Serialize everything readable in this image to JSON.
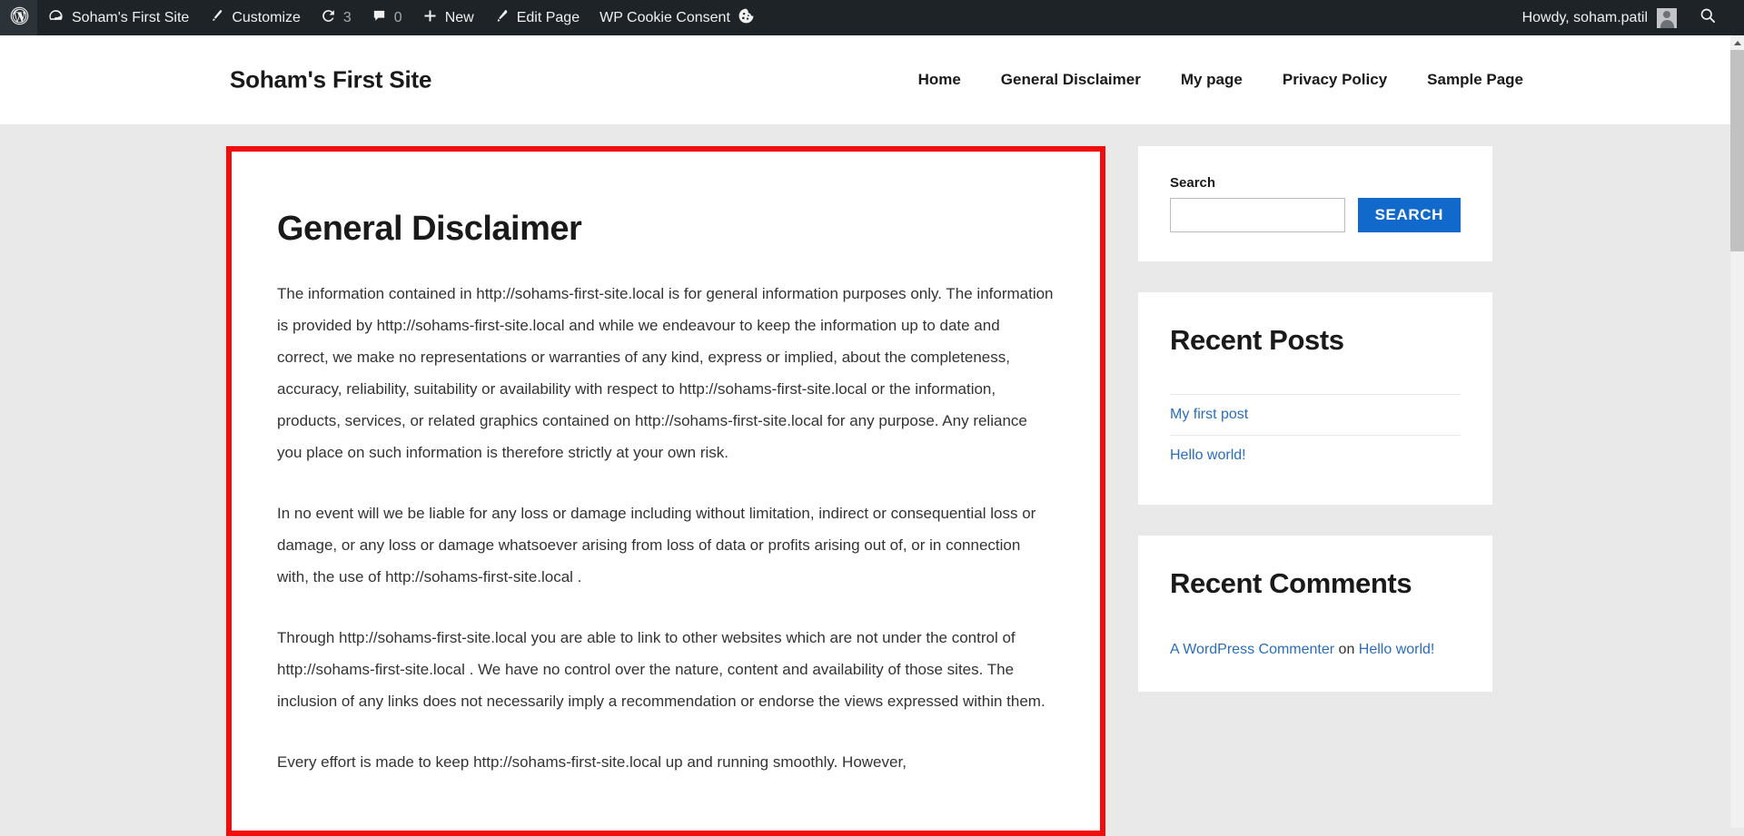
{
  "adminbar": {
    "wp_logo": "wordpress-logo",
    "site_name": "Soham's First Site",
    "customize": "Customize",
    "updates_count": "3",
    "comments_count": "0",
    "new": "New",
    "edit_page": "Edit Page",
    "cookie_consent": "WP Cookie Consent",
    "howdy": "Howdy, soham.patil"
  },
  "header": {
    "site_title": "Soham's First Site",
    "nav": [
      {
        "label": "Home"
      },
      {
        "label": "General Disclaimer"
      },
      {
        "label": "My page"
      },
      {
        "label": "Privacy Policy"
      },
      {
        "label": "Sample Page"
      }
    ]
  },
  "main": {
    "title": "General Disclaimer",
    "paragraphs": [
      "The information contained in http://sohams-first-site.local is for general information purposes only. The information is provided by http://sohams-first-site.local and while we endeavour to keep the information up to date and correct, we make no representations or warranties of any kind, express or implied, about the completeness, accuracy, reliability, suitability or availability with respect to http://sohams-first-site.local or the information, products, services, or related graphics contained on http://sohams-first-site.local for any purpose. Any reliance you place on such information is therefore strictly at your own risk.",
      "In no event will we be liable for any loss or damage including without limitation, indirect or consequential loss or damage, or any loss or damage whatsoever arising from loss of data or profits arising out of, or in connection with, the use of http://sohams-first-site.local .",
      "Through http://sohams-first-site.local you are able to link to other websites which are not under the control of http://sohams-first-site.local . We have no control over the nature, content and availability of those sites. The inclusion of any links does not necessarily imply a recommendation or endorse the views expressed within them.",
      "Every effort is made to keep http://sohams-first-site.local up and running smoothly. However,"
    ],
    "highlight_color": "#f30c0c"
  },
  "sidebar": {
    "search": {
      "label": "Search",
      "value": "",
      "placeholder": "",
      "button": "SEARCH",
      "button_color": "#1169cc"
    },
    "recent_posts": {
      "title": "Recent Posts",
      "items": [
        {
          "label": "My first post"
        },
        {
          "label": "Hello world!"
        }
      ]
    },
    "recent_comments": {
      "title": "Recent Comments",
      "author": "A WordPress Commenter",
      "on": " on ",
      "post": "Hello world!"
    }
  }
}
